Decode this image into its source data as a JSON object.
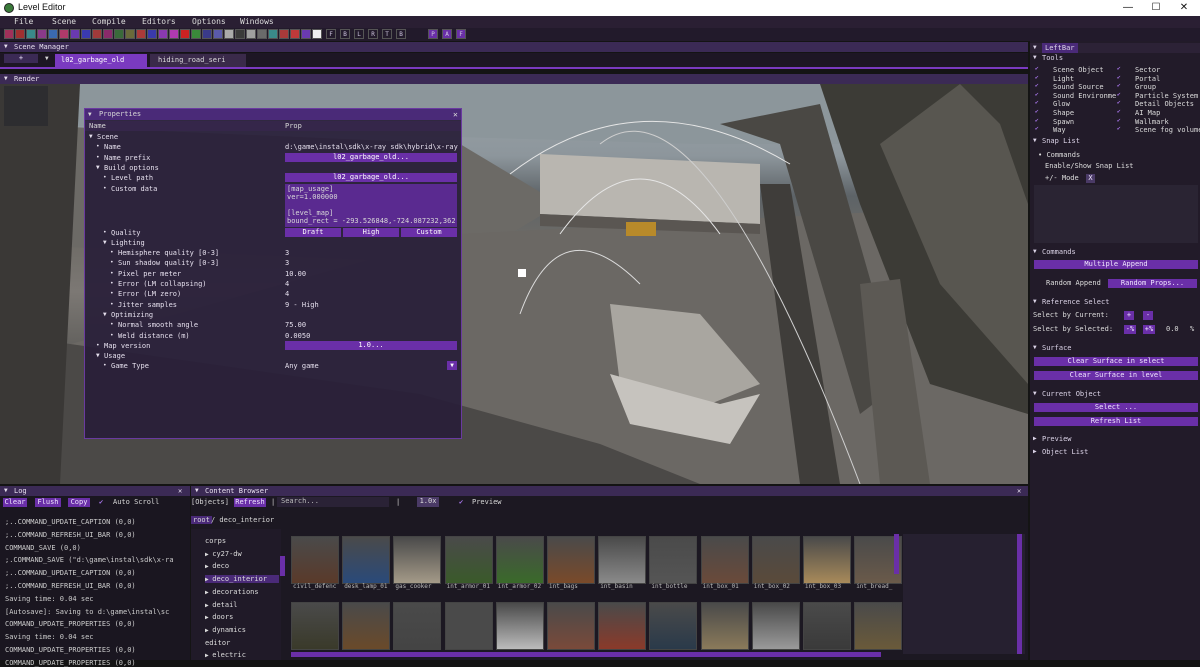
{
  "window": {
    "title": "Level Editor",
    "min": "—",
    "max": "☐",
    "close": "✕"
  },
  "menu": [
    "File",
    "Scene",
    "Compile",
    "Editors",
    "Options",
    "Windows"
  ],
  "toolbar_letters": [
    "F",
    "B",
    "L",
    "R",
    "T",
    "B",
    "P",
    "A",
    "F"
  ],
  "scene_manager": {
    "title": "Scene Manager",
    "add": "+",
    "tabs": [
      "l02_garbage_old",
      "hiding_road_seri"
    ]
  },
  "render": {
    "title": "Render"
  },
  "properties": {
    "title": "Properties",
    "col_name": "Name",
    "col_prop": "Prop",
    "rows": [
      {
        "d": 0,
        "t": "▼",
        "l": "Scene"
      },
      {
        "d": 1,
        "t": "•",
        "l": "Name",
        "v": "d:\\game\\instal\\sdk\\x-ray sdk\\hybrid\\x-ray"
      },
      {
        "d": 1,
        "t": "•",
        "l": "Name prefix",
        "b": "l02_garbage_old..."
      },
      {
        "d": 1,
        "t": "▼",
        "l": "Build options"
      },
      {
        "d": 2,
        "t": "•",
        "l": "Level path",
        "b": "l02_garbage_old..."
      },
      {
        "d": 2,
        "t": "•",
        "l": "Custom data"
      },
      {
        "d": 2,
        "t": "•",
        "l": "Quality",
        "q": [
          "Draft",
          "High",
          "Custom"
        ]
      },
      {
        "d": 2,
        "t": "▼",
        "l": "Lighting"
      },
      {
        "d": 3,
        "t": "•",
        "l": "Hemisphere quality [0-3]",
        "v": "3"
      },
      {
        "d": 3,
        "t": "•",
        "l": "Sun shadow quality [0-3]",
        "v": "3"
      },
      {
        "d": 3,
        "t": "•",
        "l": "Pixel per meter",
        "v": "10.00"
      },
      {
        "d": 3,
        "t": "•",
        "l": "Error (LM collapsing)",
        "v": "4"
      },
      {
        "d": 3,
        "t": "•",
        "l": "Error (LM zero)",
        "v": "4"
      },
      {
        "d": 3,
        "t": "•",
        "l": "Jitter samples",
        "v": "9 - High"
      },
      {
        "d": 2,
        "t": "▼",
        "l": "Optimizing"
      },
      {
        "d": 3,
        "t": "•",
        "l": "Normal smooth angle",
        "v": "75.00"
      },
      {
        "d": 3,
        "t": "•",
        "l": "Weld distance (m)",
        "v": "0.0050"
      },
      {
        "d": 1,
        "t": "•",
        "l": "Map version",
        "b": "1.0..."
      },
      {
        "d": 1,
        "t": "▼",
        "l": "Usage"
      },
      {
        "d": 2,
        "t": "•",
        "l": "Game Type",
        "v": "Any game"
      }
    ],
    "custom_data": [
      "[map_usage]",
      "ver=1.000000",
      "",
      "[level_map]",
      "bound_rect = -293.526848,-724.087232,362"
    ],
    "dropdown_arrow": "▼"
  },
  "leftbar": {
    "title": "LeftBar",
    "tools_title": "Tools",
    "tools_left": [
      "Scene Object",
      "Light",
      "Sound Source",
      "Sound Environme",
      "Glow",
      "Shape",
      "Spawn",
      "Way"
    ],
    "tools_right": [
      "Sector",
      "Portal",
      "Group",
      "Particle System",
      "Detail Objects",
      "AI Map",
      "Wallmark",
      "Scene fog volume"
    ],
    "snap_title": "Snap List",
    "snap_commands": "Commands",
    "snap_enable": "Enable/Show Snap List",
    "snap_mode": "+/- Mode",
    "snap_x": "X",
    "commands_title": "Commands",
    "multiple_append": "Multiple Append",
    "random_append": "Random Append",
    "random_props": "Random Props...",
    "ref_title": "Reference Select",
    "select_current": "Select by Current:",
    "plus": "+",
    "minus": "-",
    "select_selected": "Select by Selected:",
    "pct_minus": "-%",
    "pct_plus": "+%",
    "pct_value": "0.0",
    "pct": "%",
    "surface_title": "Surface",
    "clear_select": "Clear Surface in select",
    "clear_level": "Clear Surface in level",
    "current_title": "Current Object",
    "select_btn": "Select ...",
    "refresh_list": "Refresh List",
    "preview": "Preview",
    "object_list": "Object List"
  },
  "log": {
    "title": "Log",
    "clear": "Clear",
    "flush": "Flush",
    "copy": "Copy",
    "auto_scroll": "Auto Scroll",
    "lines": [
      ";..COMMAND_UPDATE_CAPTION (0,0)",
      ";..COMMAND_REFRESH_UI_BAR (0,0)",
      "COMMAND_SAVE (0,0)",
      ";.COMMAND_SAVE (\"d:\\game\\instal\\sdk\\x-ra",
      ";..COMMAND_UPDATE_CAPTION (0,0)",
      ";..COMMAND_REFRESH_UI_BAR (0,0)",
      "Saving time: 0.04 sec",
      " [Autosave]: Saving to d:\\game\\instal\\sc",
      "COMMAND_UPDATE_PROPERTIES (0,0)",
      "Saving time: 0.04 sec",
      "COMMAND_UPDATE_PROPERTIES (0,0)",
      "COMMAND_UPDATE_PROPERTIES (0,0)"
    ]
  },
  "content": {
    "title": "Content Browser",
    "objects": "[Objects]",
    "refresh": "Refresh",
    "search": "Search...",
    "sep": "|",
    "zoom": "1.0x",
    "preview": "Preview",
    "path_root": "root",
    "path": "/ deco_interior",
    "tree": [
      "corps",
      "cy27-dw",
      "deco",
      "deco_interior",
      "decorations",
      "detail",
      "doors",
      "dynamics",
      "editor",
      "electric"
    ],
    "items_row1": [
      "civil_defenc",
      "desk_lamp_01",
      "gas_cooker",
      "int_armor_01",
      "int_armor_02",
      "int_bags",
      "int_basin",
      "int_bottle",
      "int_box_01",
      "int_box_02",
      "int_box_03",
      "int_bread_"
    ],
    "colors_row1": [
      "#5a3a2a",
      "#2a4a7a",
      "#a49a88",
      "#3a5a2a",
      "#3a6a2a",
      "#7a4a2a",
      "#8a8a8a",
      "#555555",
      "#6a4a3a",
      "#5a4a3a",
      "#a88a5a",
      "#6a5a4a"
    ],
    "colors_row2": [
      "#3a3a2a",
      "#6a4a2a",
      "#444444",
      "#4a4a4a",
      "#bbbbbb",
      "#7a4a3a",
      "#8a3a2a",
      "#2a3a4a",
      "#8a7a5a",
      "#9a9a9a",
      "#3a3a3a",
      "#6a5a3a"
    ]
  }
}
